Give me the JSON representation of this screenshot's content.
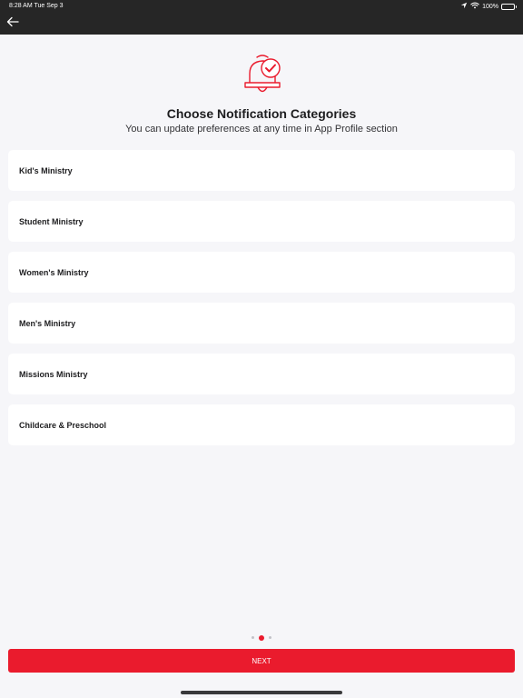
{
  "status_bar": {
    "time": "8:28 AM   Tue Sep 3",
    "battery": "100%",
    "icons": [
      "location-icon",
      "wifi-icon",
      "battery-icon"
    ]
  },
  "nav": {
    "back_icon": "arrow-left-icon"
  },
  "header": {
    "icon": "notification-bell-check-icon",
    "title": "Choose Notification Categories",
    "subtitle": "You can update preferences at any time in App Profile section"
  },
  "categories": [
    {
      "label": "Kid's Ministry"
    },
    {
      "label": "Student Ministry"
    },
    {
      "label": "Women's Ministry"
    },
    {
      "label": "Men's Ministry"
    },
    {
      "label": "Missions Ministry"
    },
    {
      "label": "Childcare & Preschool"
    }
  ],
  "pager": {
    "total": 3,
    "active": 2
  },
  "footer": {
    "next_label": "NEXT"
  },
  "colors": {
    "accent": "#ea1b2d",
    "topbar": "#262626",
    "background": "#f6f6f9",
    "card": "#ffffff"
  }
}
